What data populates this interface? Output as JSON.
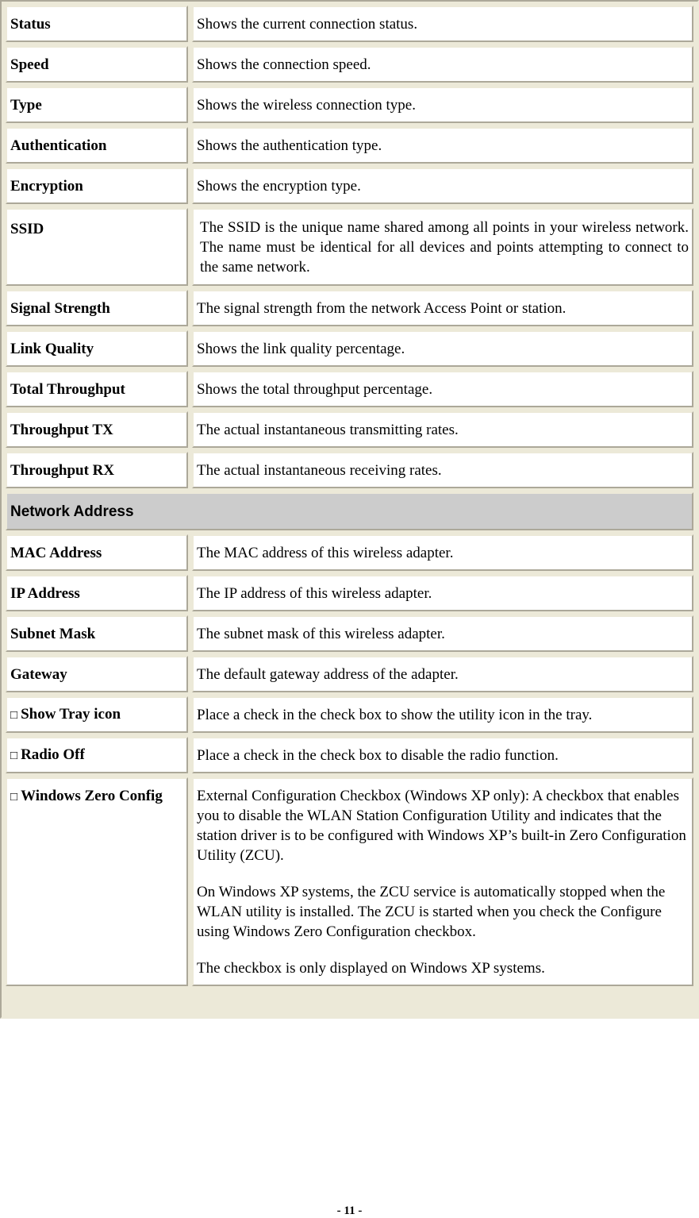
{
  "rows": [
    {
      "label": "Status",
      "desc": "Shows the current connection status."
    },
    {
      "label": "Speed",
      "desc": "Shows the connection speed."
    },
    {
      "label": "Type",
      "desc": "Shows the wireless connection type."
    },
    {
      "label": "Authentication",
      "desc": "Shows the authentication type."
    },
    {
      "label": "Encryption",
      "desc": "Shows the encryption type."
    },
    {
      "label": "SSID",
      "desc": "The SSID is the unique name shared among all points in your wireless network. The name must be identical for all devices and points attempting to connect to the same network."
    },
    {
      "label": "Signal Strength",
      "desc": "The signal strength from the network Access Point or station."
    },
    {
      "label": "Link Quality",
      "desc": "Shows the link quality percentage."
    },
    {
      "label": "Total Throughput",
      "desc": "Shows the total throughput percentage."
    },
    {
      "label": "Throughput TX",
      "desc": "The actual instantaneous transmitting rates."
    },
    {
      "label": "Throughput RX",
      "desc": "The actual instantaneous receiving rates."
    }
  ],
  "section_network": "Network Address",
  "network_rows": [
    {
      "label": "MAC Address",
      "desc": "The MAC address of this wireless adapter."
    },
    {
      "label": "IP Address",
      "desc": "The IP address of this wireless adapter."
    },
    {
      "label": "Subnet Mask",
      "desc": "The subnet mask of this wireless adapter."
    },
    {
      "label": "Gateway",
      "desc": "The default gateway address of the adapter."
    }
  ],
  "checkbox_glyph": "□",
  "checkbox_rows": [
    {
      "label": "Show Tray icon",
      "desc": "Place a check in the check box to show the utility icon in the tray."
    },
    {
      "label": "Radio Off",
      "desc": "Place a check in the check box to disable the radio function."
    }
  ],
  "wzc": {
    "label": "Windows Zero Config",
    "paragraphs": [
      "External Configuration Checkbox (Windows XP only): A checkbox that enables you to disable the WLAN Station Configuration Utility and indicates that the station driver is to be configured with Windows XP’s built-in Zero Configuration Utility (ZCU).",
      "On Windows XP systems, the ZCU service is automatically stopped when the WLAN utility is installed. The ZCU is started when you check the Configure using Windows Zero Configuration checkbox.",
      "The checkbox is only displayed on Windows XP systems."
    ]
  },
  "footer": "- 11 -"
}
